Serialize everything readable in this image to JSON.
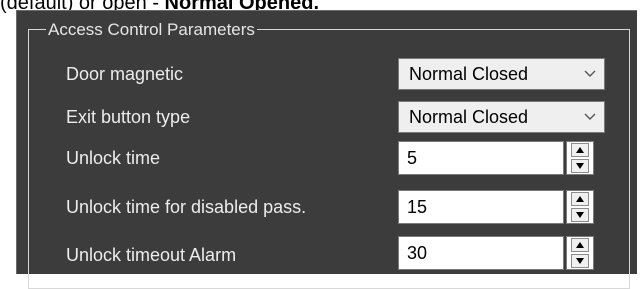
{
  "caption": {
    "prefix": "(default) or open - ",
    "emphasis": "Normal Opened."
  },
  "group": {
    "title": "Access Control Parameters"
  },
  "rows": [
    {
      "label": "Door magnetic",
      "control": "combo",
      "value": "Normal Closed"
    },
    {
      "label": "Exit button type",
      "control": "combo",
      "value": "Normal Closed"
    },
    {
      "label": "Unlock time",
      "control": "spin",
      "value": "5"
    },
    {
      "label": "Unlock time for disabled pass.",
      "control": "spin",
      "value": "15"
    },
    {
      "label": "Unlock timeout Alarm",
      "control": "spin",
      "value": "30"
    }
  ],
  "icons": {
    "combo_arrow": "chevron-down-icon",
    "spin_up": "spin-up-arrow-icon",
    "spin_down": "spin-down-arrow-icon"
  },
  "colors": {
    "panel_background": "#3c3c3c",
    "label_text": "#ececec",
    "group_border": "#d8d8d8"
  }
}
